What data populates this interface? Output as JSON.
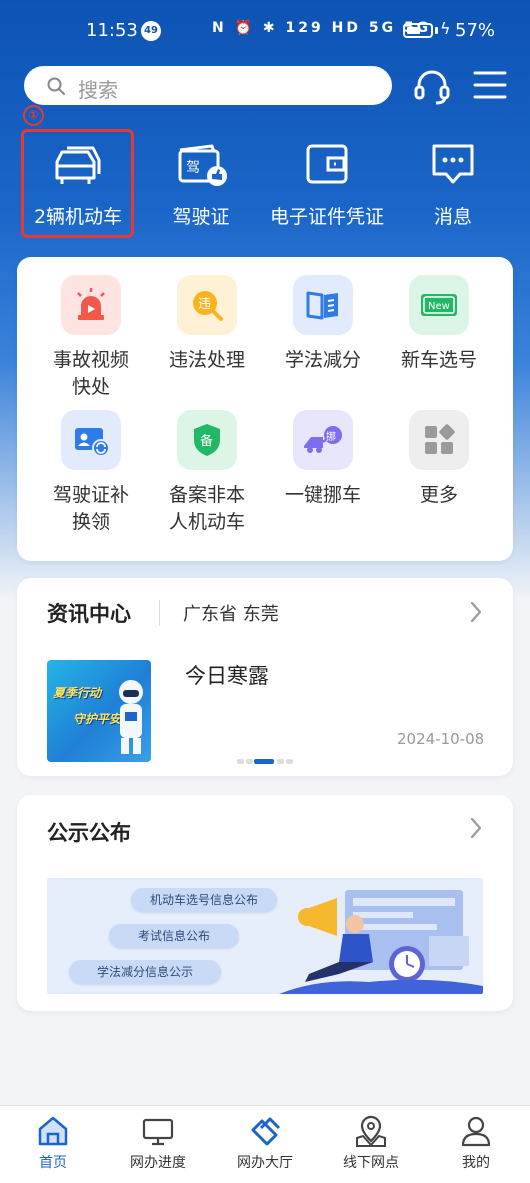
{
  "status_bar": {
    "time": "11:53",
    "notification_count": "49",
    "net_speed": "129",
    "battery": "57%"
  },
  "search": {
    "placeholder": "搜索"
  },
  "marker": "①",
  "quick_actions": [
    {
      "label": "2辆机动车",
      "icon": "cars-icon"
    },
    {
      "label": "驾驶证",
      "icon": "license-icon"
    },
    {
      "label": "电子证件凭证",
      "icon": "wallet-icon"
    },
    {
      "label": "消息",
      "icon": "message-icon"
    }
  ],
  "services": [
    {
      "label_1": "事故视频",
      "label_2": "快处",
      "icon": "alarm-icon"
    },
    {
      "label_1": "违法处理",
      "label_2": "",
      "icon": "violation-icon",
      "glyph": "违"
    },
    {
      "label_1": "学法减分",
      "label_2": "",
      "icon": "book-icon"
    },
    {
      "label_1": "新车选号",
      "label_2": "",
      "icon": "new-plate-icon",
      "glyph": "New"
    },
    {
      "label_1": "驾驶证补",
      "label_2": "换领",
      "icon": "license-card-icon"
    },
    {
      "label_1": "备案非本",
      "label_2": "人机动车",
      "icon": "shield-icon",
      "glyph": "备"
    },
    {
      "label_1": "一键挪车",
      "label_2": "",
      "icon": "tow-truck-icon",
      "glyph": "挪"
    },
    {
      "label_1": "更多",
      "label_2": "",
      "icon": "more-icon"
    }
  ],
  "news": {
    "title": "资讯中心",
    "region": "广东省 东莞",
    "thumb_line_1": "夏季行动",
    "thumb_line_2": "守护平安",
    "headline": "今日寒露",
    "date": "2024-10-08"
  },
  "notice": {
    "title": "公示公布",
    "items": [
      "机动车选号信息公布",
      "考试信息公布",
      "学法减分信息公示"
    ]
  },
  "bottom_nav": [
    {
      "label": "首页",
      "icon": "home-icon",
      "active": true
    },
    {
      "label": "网办进度",
      "icon": "monitor-icon",
      "active": false
    },
    {
      "label": "网办大厅",
      "icon": "hall-icon",
      "active": false
    },
    {
      "label": "线下网点",
      "icon": "location-icon",
      "active": false
    },
    {
      "label": "我的",
      "icon": "user-icon",
      "active": false
    }
  ],
  "colors": {
    "primary": "#1a66c8",
    "header_top": "#0d53b3",
    "highlight": "#e53935"
  }
}
